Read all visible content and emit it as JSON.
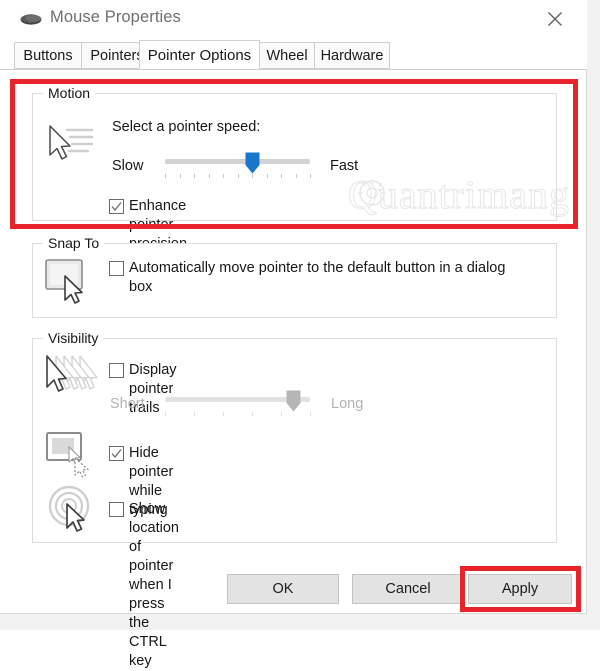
{
  "window": {
    "title": "Mouse Properties",
    "icon": "mouse-icon",
    "close_label": "✕"
  },
  "tabs": [
    {
      "label": "Buttons",
      "selected": false
    },
    {
      "label": "Pointers",
      "selected": false
    },
    {
      "label": "Pointer Options",
      "selected": true
    },
    {
      "label": "Wheel",
      "selected": false
    },
    {
      "label": "Hardware",
      "selected": false
    }
  ],
  "groups": {
    "motion": {
      "legend": "Motion",
      "speed_label": "Select a pointer speed:",
      "slider": {
        "min_label": "Slow",
        "max_label": "Fast",
        "value_percent": 60,
        "tick_count": 11,
        "enabled": true,
        "thumb_color": "#1877cc"
      },
      "enhance_precision": {
        "label": "Enhance pointer precision",
        "checked": true
      }
    },
    "snap_to": {
      "legend": "Snap To",
      "auto_move": {
        "label": "Automatically move pointer to the default button in a dialog box",
        "checked": false
      }
    },
    "visibility": {
      "legend": "Visibility",
      "display_trails": {
        "label": "Display pointer trails",
        "checked": false
      },
      "trails_slider": {
        "min_label": "Short",
        "max_label": "Long",
        "value_percent": 88,
        "tick_count": 6,
        "enabled": false,
        "thumb_color": "#b6b6b6"
      },
      "hide_while_typing": {
        "label": "Hide pointer while typing",
        "checked": true
      },
      "show_location": {
        "label": "Show location of pointer when I press the CTRL key",
        "checked": false
      }
    }
  },
  "buttons": {
    "ok": "OK",
    "cancel": "Cancel",
    "apply": "Apply"
  },
  "highlights": {
    "color": "#e8232a",
    "targets": [
      "motion-group",
      "apply-button"
    ]
  },
  "watermark": {
    "text": "Quantrimang"
  }
}
